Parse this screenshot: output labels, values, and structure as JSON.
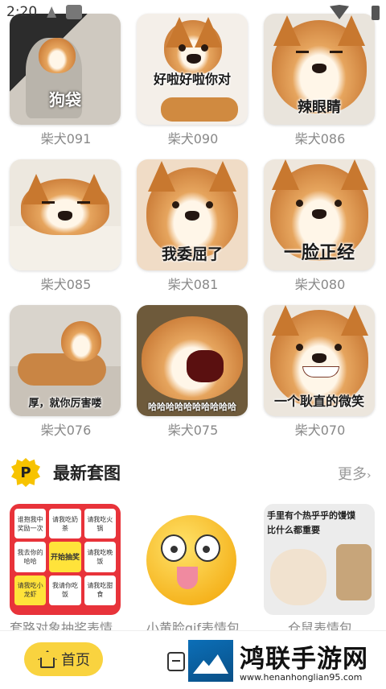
{
  "status_bar": {
    "time": "2:20"
  },
  "grid": [
    {
      "label": "柴犬091",
      "caption": "狗袋"
    },
    {
      "label": "柴犬090",
      "caption": "好啦好啦你对"
    },
    {
      "label": "柴犬086",
      "caption": "辣眼睛"
    },
    {
      "label": "柴犬085",
      "caption": ""
    },
    {
      "label": "柴犬081",
      "caption": "我委屈了"
    },
    {
      "label": "柴犬080",
      "caption": "一脸正经"
    },
    {
      "label": "柴犬076",
      "caption": "厚，就你厉害喽"
    },
    {
      "label": "柴犬075",
      "caption": "哈哈哈哈哈哈哈哈哈哈"
    },
    {
      "label": "柴犬070",
      "caption": "一个耿直的微笑"
    }
  ],
  "section": {
    "icon_letter": "P",
    "title": "最新套图",
    "more": "更多"
  },
  "sets": [
    {
      "label": "套路对象抽奖表情...",
      "cells": [
        "谁抱我中奖励一次",
        "请我吃奶茶",
        "请我吃火锅",
        "我去你的哈哈",
        "开始抽奖",
        "请我吃晚饭",
        "请我吃小龙虾",
        "我请你吃饭",
        "请我吃甜食"
      ]
    },
    {
      "label": "小黄脸gif表情包"
    },
    {
      "label": "仓鼠表情包",
      "line1": "手里有个热乎乎的馒馍",
      "line2": "比什么都重要"
    }
  ],
  "bottom_nav": {
    "home_label": "首页"
  },
  "watermark": {
    "title": "鸿联手游网",
    "url": "www.henanhonglian95.com"
  },
  "colors": {
    "accent": "#f9d33f",
    "label_gray": "#888888",
    "lottery_red": "#e8333a"
  }
}
